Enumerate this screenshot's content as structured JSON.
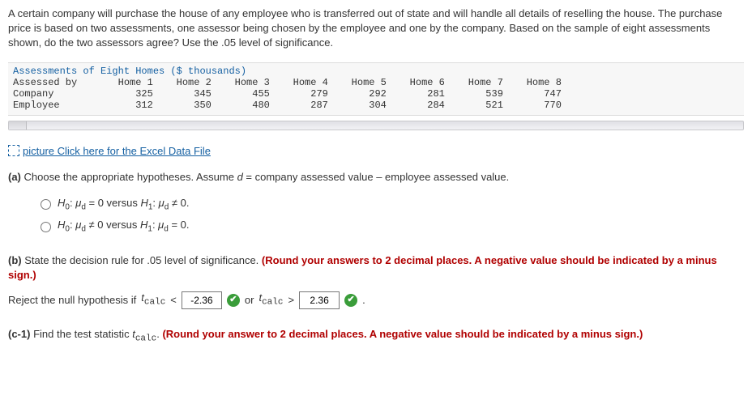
{
  "problem": {
    "intro": "A certain company will purchase the house of any employee who is transferred out of state and will handle all details of reselling the house. The purchase price is based on two assessments, one assessor being chosen by the employee and one by the company. Based on the sample of eight assessments shown, do the two assessors agree? Use the .05 level of significance."
  },
  "table": {
    "title": "Assessments of Eight Homes ($ thousands)",
    "header_label": "Assessed by",
    "columns": [
      "Home 1",
      "Home 2",
      "Home 3",
      "Home 4",
      "Home 5",
      "Home 6",
      "Home 7",
      "Home 8"
    ],
    "rows": [
      {
        "label": "Company",
        "values": [
          "325",
          "345",
          "455",
          "279",
          "292",
          "281",
          "539",
          "747"
        ]
      },
      {
        "label": "Employee",
        "values": [
          "312",
          "350",
          "480",
          "287",
          "304",
          "284",
          "521",
          "770"
        ]
      }
    ]
  },
  "excel_link": "picture Click here for the Excel Data File",
  "part_a": {
    "label": "(a)",
    "prompt": "Choose the appropriate hypotheses. Assume d = company assessed value − employee assessed value.",
    "options": [
      "H₀: μ_d = 0 versus H₁: μ_d ≠ 0.",
      "H₀: μ_d ≠ 0 versus H₁: μ_d = 0."
    ]
  },
  "part_b": {
    "label": "(b)",
    "prompt": "State the decision rule for .05 level of significance.",
    "hint": "(Round your answers to 2 decimal places. A negative value should be indicated by a minus sign.)",
    "rule_prefix": "Reject the null hypothesis if ",
    "t_label": "t",
    "t_sub": "calc",
    "lt": "<",
    "gt": ">",
    "or": "or",
    "val_low": "-2.36",
    "val_high": "2.36",
    "period": "."
  },
  "part_c1": {
    "label": "(c-1)",
    "prompt": "Find the test statistic ",
    "t_label": "t",
    "t_sub": "calc",
    "suffix": ".",
    "hint": "(Round your answer to 2 decimal places. A negative value should be indicated by a minus sign.)"
  }
}
